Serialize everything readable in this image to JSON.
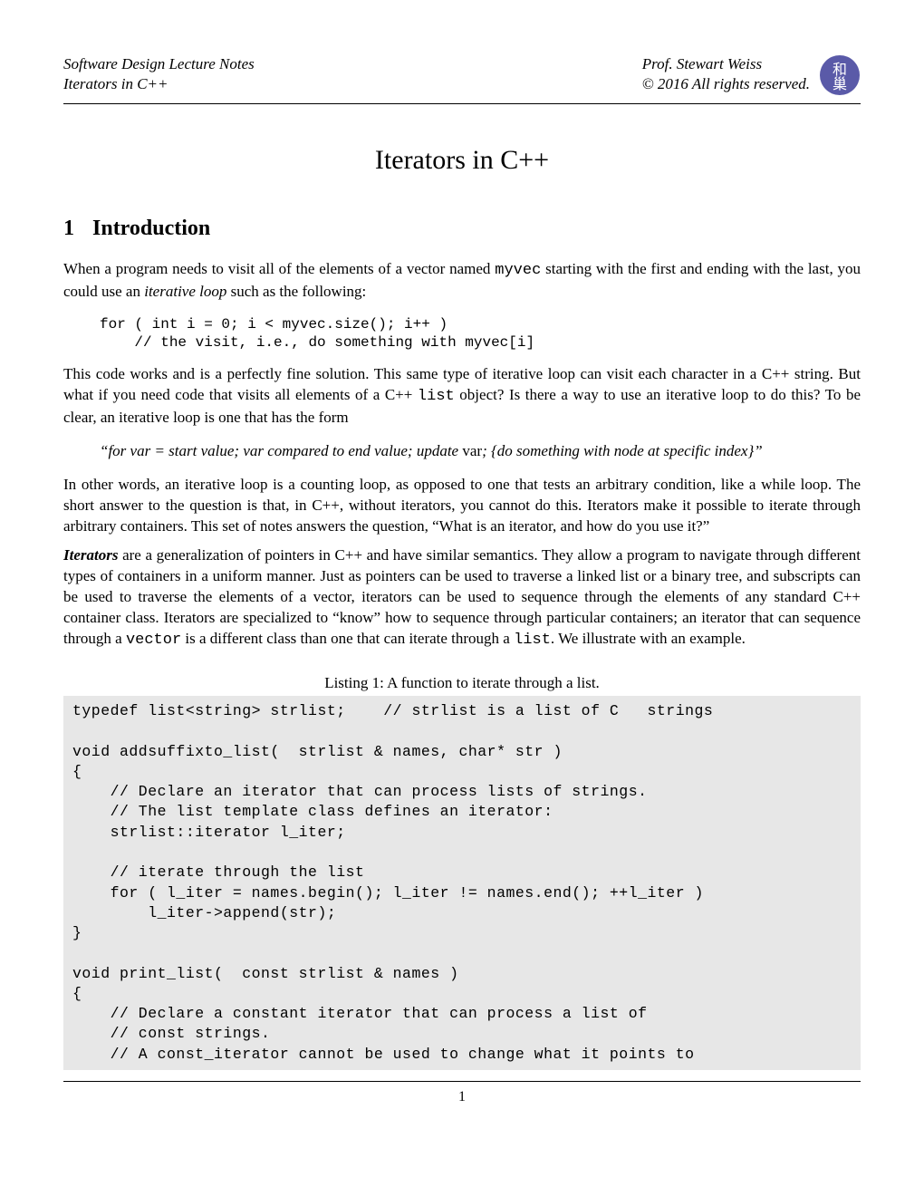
{
  "header": {
    "left_line1": "Software Design Lecture Notes",
    "left_line2": "Iterators in C++",
    "right_line1": "Prof. Stewart Weiss",
    "right_line2": "©  2016 All rights reserved."
  },
  "title": "Iterators in C++",
  "section": {
    "num": "1",
    "name": "Introduction"
  },
  "para1_a": "When a program needs to visit all of the elements of a vector named ",
  "para1_myvec": "myvec",
  "para1_b": " starting with the first and ending with the last, you could use an ",
  "para1_iterloop": "iterative loop",
  "para1_c": " such as the following:",
  "codeblock1": "for ( int i = 0; i < myvec.size(); i++ )\n    // the visit, i.e., do something with myvec[i]",
  "para2_a": "This code works and is a perfectly fine solution. This same type of iterative loop can visit each character in a C++ string. But what if you need code that visits all elements of a C++ ",
  "para2_list": "list",
  "para2_b": " object? Is there a way to use an iterative loop to do this? To be clear, an iterative loop is one that has the form",
  "quote_a": "“for var = start value; var compared to end value; update ",
  "quote_var": "var",
  "quote_b": "; {do something with node at specific index}”",
  "para3": "In other words, an iterative loop is a counting loop, as opposed to one that tests an arbitrary condition, like a while loop. The short answer to the question is that, in C++, without iterators, you cannot do this. Iterators make it possible to iterate through arbitrary containers. This set of notes answers the question, “What is an iterator, and how do you use it?”",
  "para4_lead": "Iterators",
  "para4_a": " are a generalization of pointers in C++ and have similar semantics. They allow a program to navigate through different types of containers in a uniform manner. Just as pointers can be used to traverse a linked list or a binary tree, and subscripts can be used to traverse the elements of a vector, iterators can be used to sequence through the elements of any standard C++ container class. Iterators are specialized to “know” how to sequence through particular containers; an iterator that can sequence through a ",
  "para4_vector": "vector",
  "para4_b": " is a different class than one that can iterate through a ",
  "para4_list": "list",
  "para4_c": ". We illustrate with an example.",
  "listing_caption": "Listing 1: A function to iterate through a list.",
  "listing_code": "typedef list<string> strlist;    // strlist is a list of C   strings\n\nvoid addsuffixto_list(  strlist & names, char* str )\n{\n    // Declare an iterator that can process lists of strings.\n    // The list template class defines an iterator:\n    strlist::iterator l_iter;\n\n    // iterate through the list\n    for ( l_iter = names.begin(); l_iter != names.end(); ++l_iter )\n        l_iter->append(str);\n}\n\nvoid print_list(  const strlist & names )\n{\n    // Declare a constant iterator that can process a list of\n    // const strings.\n    // A const_iterator cannot be used to change what it points to",
  "page_number": "1"
}
